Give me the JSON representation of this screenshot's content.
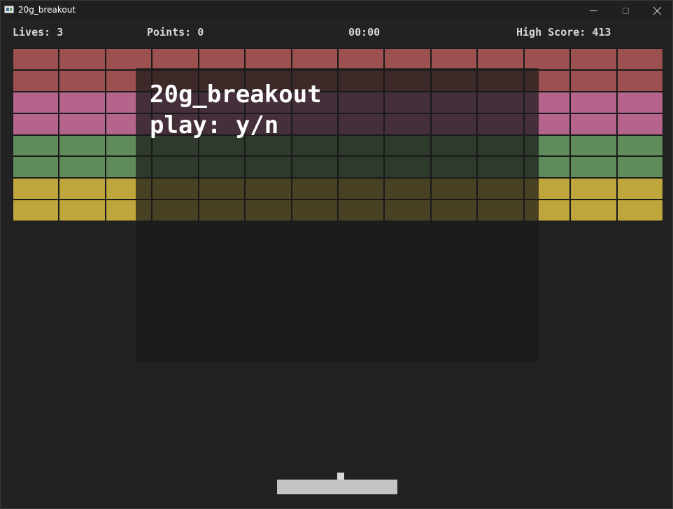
{
  "window": {
    "title": "20g_breakout",
    "icon": "app-icon",
    "controls": [
      "minimize-icon",
      "maximize-icon",
      "close-icon"
    ]
  },
  "hud": {
    "lives": "Lives: 3",
    "points": "Points: 0",
    "time": "00:00",
    "high_score": "High Score: 413"
  },
  "bricks": {
    "columns": 14,
    "rows": [
      {
        "color": "#9c5050"
      },
      {
        "color": "#9c5050"
      },
      {
        "color": "#b5658c"
      },
      {
        "color": "#b5658c"
      },
      {
        "color": "#608c5c"
      },
      {
        "color": "#608c5c"
      },
      {
        "color": "#bea63c"
      },
      {
        "color": "#bea63c"
      }
    ]
  },
  "overlay": {
    "title": "20g_breakout",
    "prompt": "play: y/n"
  },
  "colors": {
    "background": "#222222",
    "paddle": "#c4c4c4",
    "ball": "#d8d8d8",
    "hud_text": "#d8d8d8",
    "overlay_text": "#ffffff"
  }
}
